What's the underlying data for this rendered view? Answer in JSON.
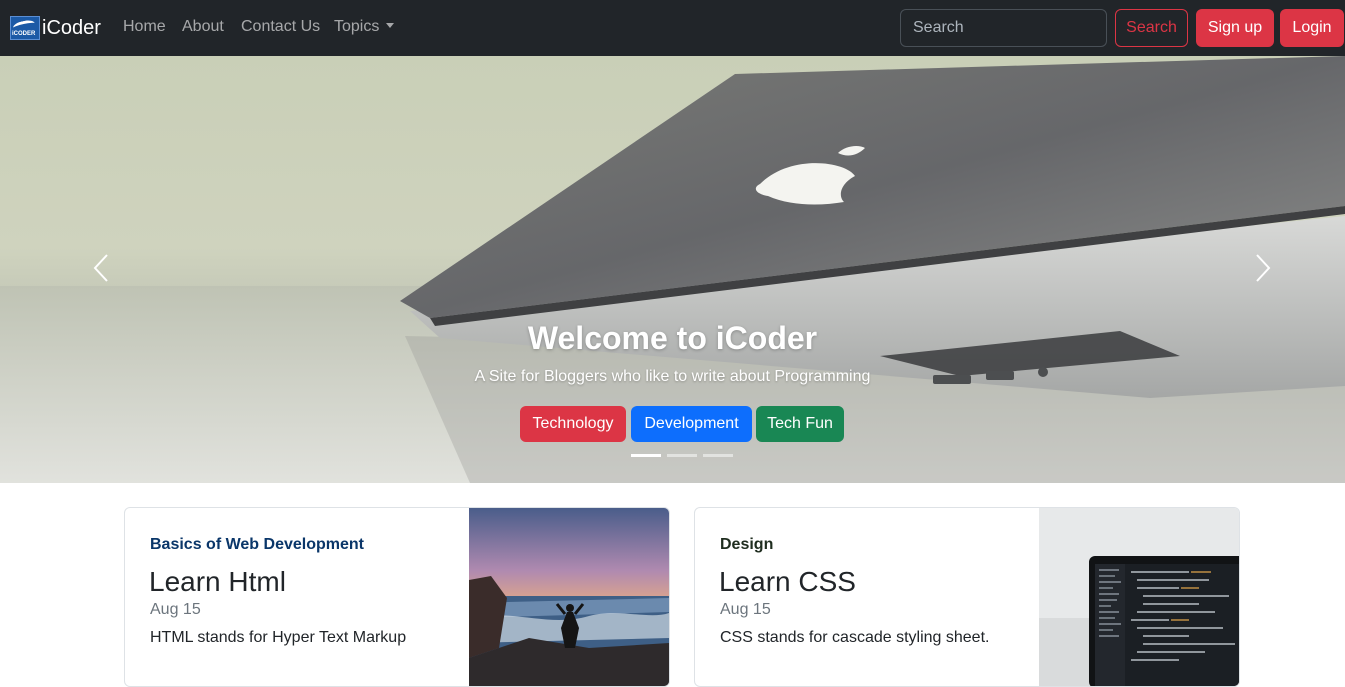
{
  "navbar": {
    "brand": {
      "logo_text": "iCODER",
      "name": "iCoder"
    },
    "links": [
      "Home",
      "About",
      "Contact Us",
      "Topics"
    ],
    "search": {
      "placeholder": "Search",
      "button_label": "Search"
    },
    "signup_label": "Sign up",
    "login_label": "Login"
  },
  "carousel": {
    "title": "Welcome to iCoder",
    "subtitle": "A Site for Bloggers who like to write about Programming",
    "buttons": [
      "Technology",
      "Development",
      "Tech Fun"
    ],
    "slide_count": 3,
    "active_slide": 1
  },
  "cards": [
    {
      "category": "Basics of Web Development",
      "title": "Learn Html",
      "date": "Aug 15",
      "text": "HTML stands for Hyper Text Markup"
    },
    {
      "category": "Design",
      "title": "Learn CSS",
      "date": "Aug 15",
      "text": "CSS stands for cascade styling sheet."
    }
  ],
  "colors": {
    "navbar_bg": "#212529",
    "danger": "#dc3545",
    "primary": "#0d6efd",
    "success": "#198754"
  }
}
